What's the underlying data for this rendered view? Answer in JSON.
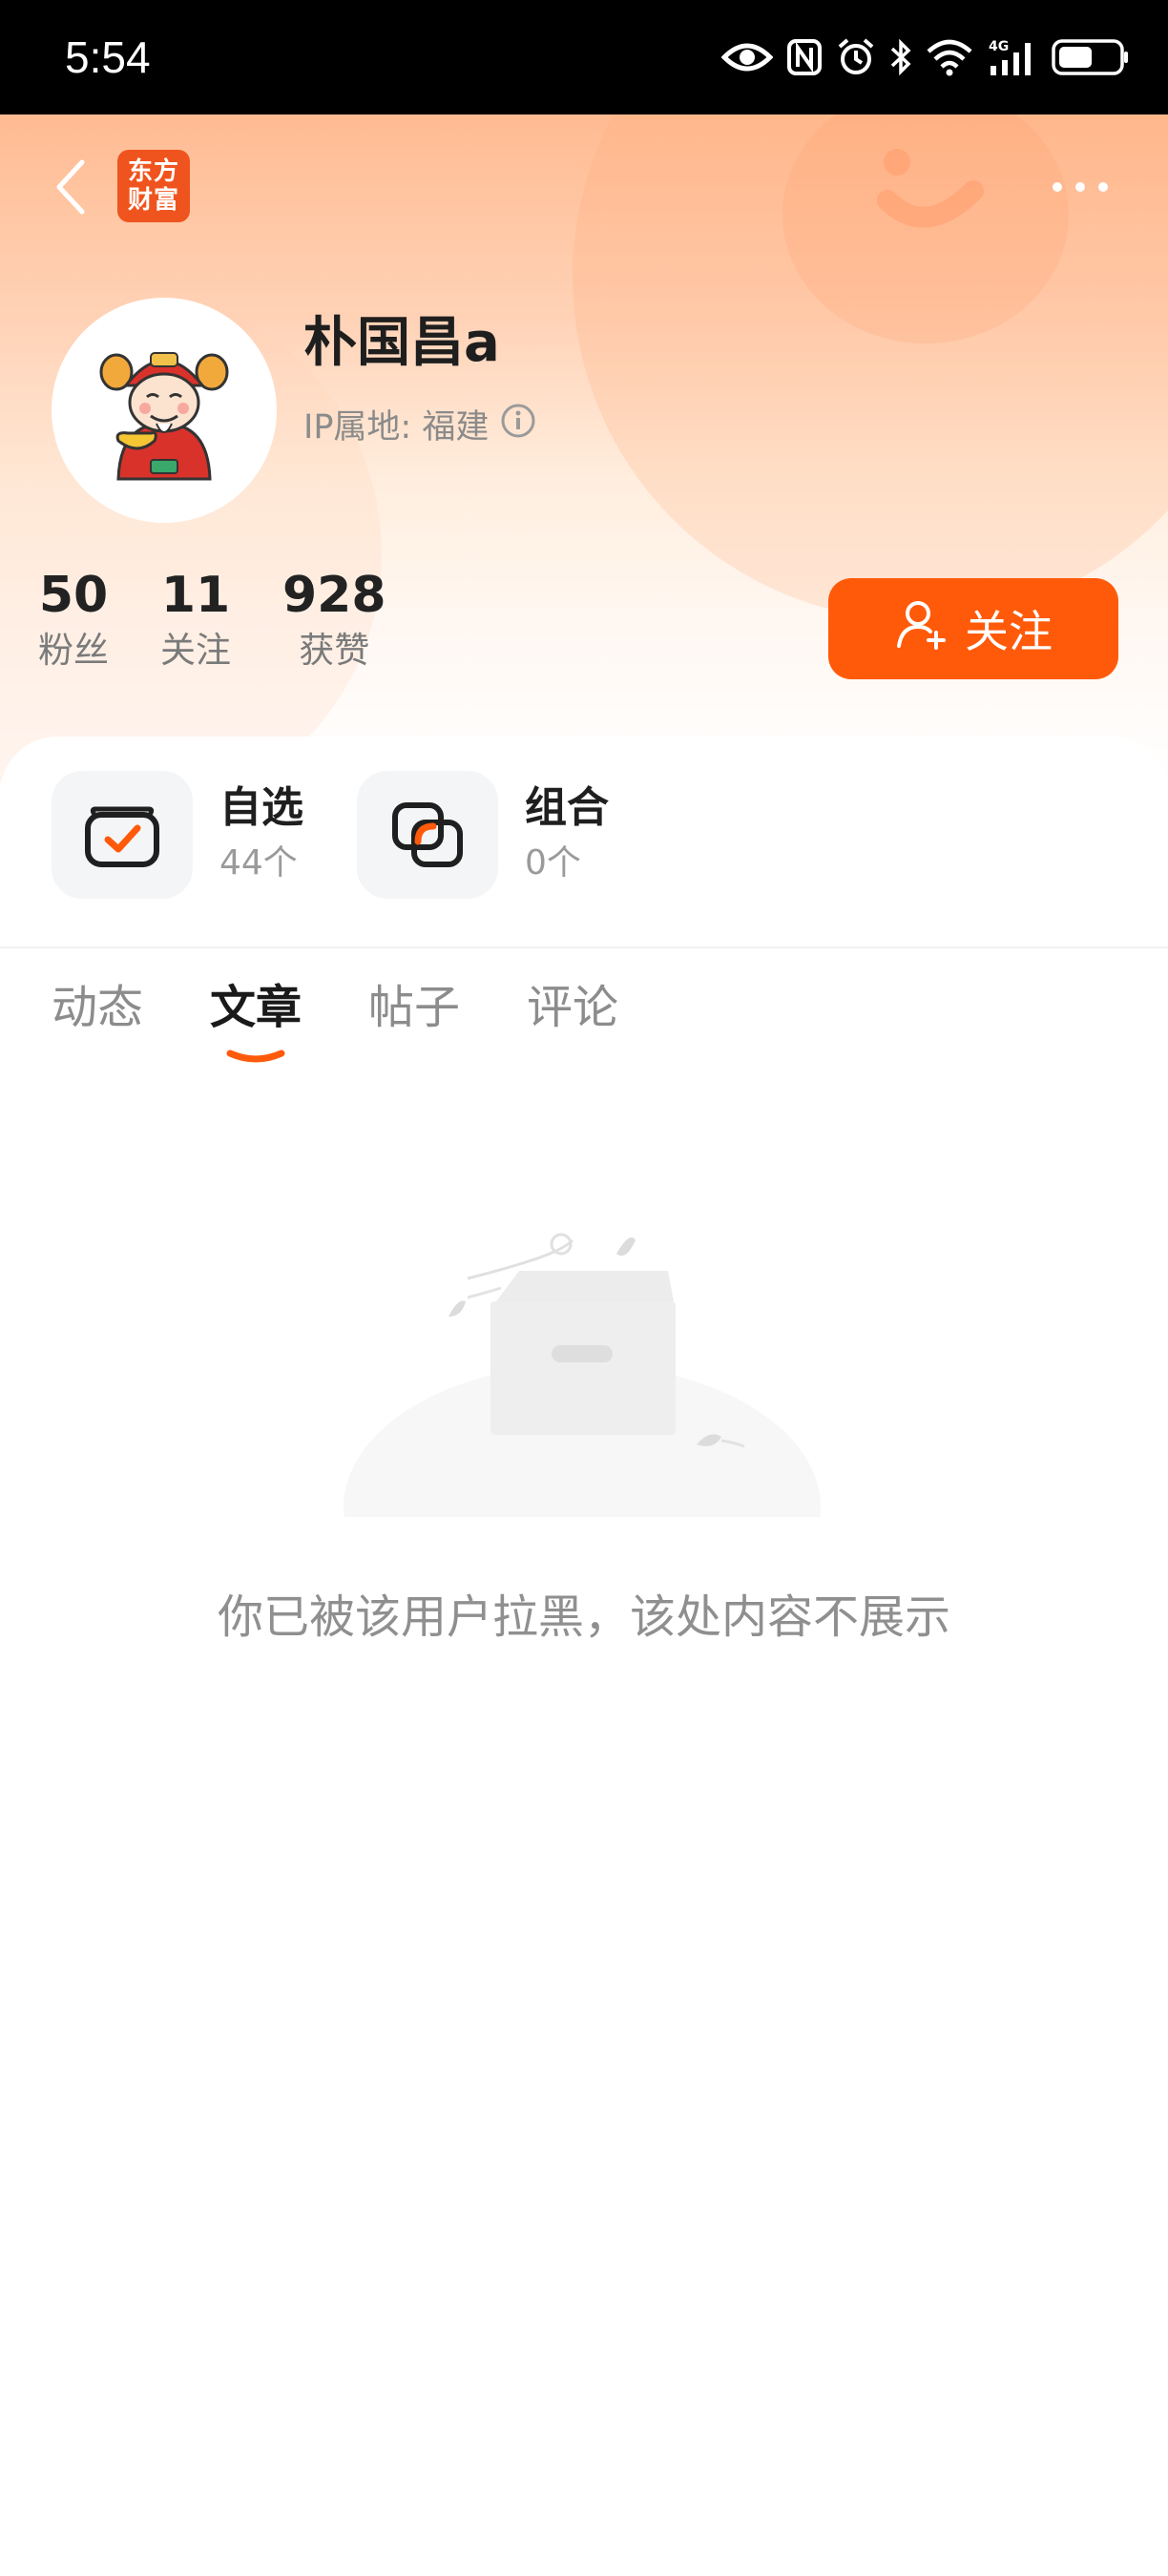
{
  "status_bar": {
    "time": "5:54",
    "icons": [
      "eye-icon",
      "nfc-icon",
      "alarm-icon",
      "bluetooth-icon",
      "wifi-icon",
      "signal-4g-icon",
      "battery-icon"
    ],
    "network": "4G"
  },
  "header": {
    "logo_line1": "东方",
    "logo_line2": "财富",
    "logo_color": "#f0541e"
  },
  "profile": {
    "name": "朴国昌a",
    "ip_label": "IP属地: 福建",
    "stats": [
      {
        "value": "50",
        "label": "粉丝"
      },
      {
        "value": "11",
        "label": "关注"
      },
      {
        "value": "928",
        "label": "获赞"
      }
    ],
    "follow_label": "关注",
    "accent_color": "#ff5a0a"
  },
  "shortcuts": [
    {
      "title": "自选",
      "count": "44个"
    },
    {
      "title": "组合",
      "count": "0个"
    }
  ],
  "tabs": [
    {
      "label": "动态"
    },
    {
      "label": "文章",
      "active": true
    },
    {
      "label": "帖子"
    },
    {
      "label": "评论"
    }
  ],
  "empty_state": {
    "message": "你已被该用户拉黑，该处内容不展示"
  }
}
